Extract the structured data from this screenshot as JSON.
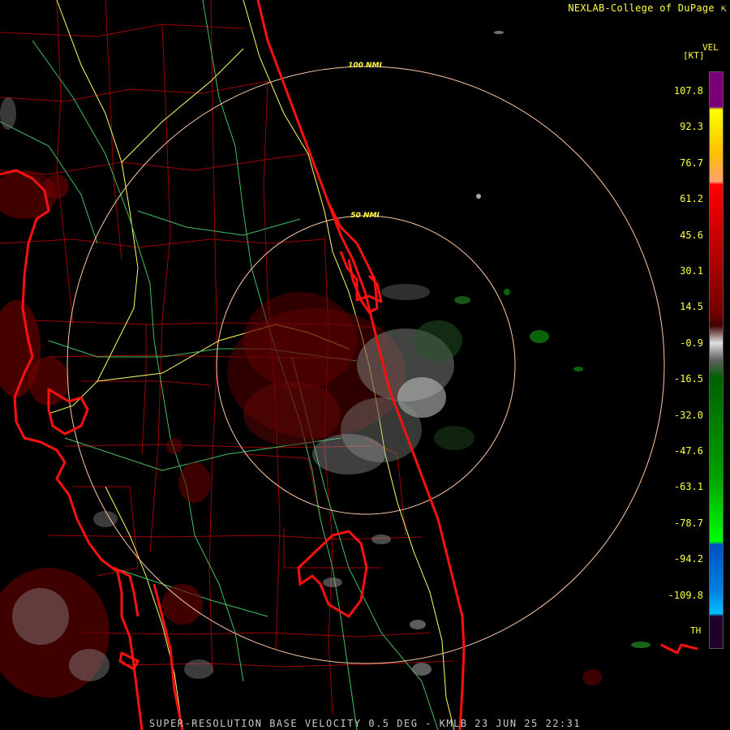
{
  "header": {
    "credit": "NEXLAB-College of DuPage",
    "credit_icon": "arrow-icon"
  },
  "footer": {
    "product_line": "SUPER-RESOLUTION BASE VELOCITY 0.5 DEG - KMLB 23 JUN 25 22:31"
  },
  "range_rings": [
    {
      "label": "100 NMI"
    },
    {
      "label": "50 NMI"
    }
  ],
  "legend": {
    "title": "VEL",
    "unit": "[KT]",
    "ticks": [
      "107.8",
      "92.3",
      "76.7",
      "61.2",
      "45.6",
      "30.1",
      "14.5",
      "-0.9",
      "-16.5",
      "-32.0",
      "-47.6",
      "-63.1",
      "-78.7",
      "-94.2",
      "-109.8"
    ],
    "range_folded_label": "TH",
    "colors": {
      "purple": "#7a007a",
      "yellow": "#ffff00",
      "peach": "#ffa070",
      "red": "#ff0000",
      "dark_red": "#700000",
      "white": "#e0e0e0",
      "dark_green": "#006000",
      "green": "#00ff00",
      "blue": "#0050c0",
      "cyan": "#00c0ff",
      "range_folded": "#20002a"
    }
  },
  "map_colors": {
    "coast": "#ff0000",
    "county": "#c00000",
    "roads_yellow": "#ffff60",
    "roads_green": "#40c060",
    "ring": "#ffc8a0"
  }
}
